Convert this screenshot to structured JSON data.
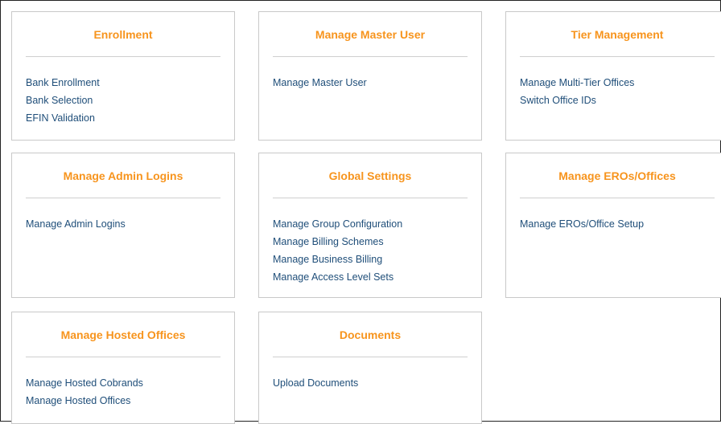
{
  "cards": [
    {
      "title": "Enrollment",
      "links": [
        "Bank Enrollment",
        "Bank Selection",
        "EFIN Validation"
      ]
    },
    {
      "title": "Manage Master User",
      "links": [
        "Manage Master User"
      ]
    },
    {
      "title": "Tier Management",
      "links": [
        "Manage Multi-Tier Offices",
        "Switch Office IDs"
      ]
    },
    {
      "title": "Manage Admin Logins",
      "links": [
        "Manage Admin Logins"
      ]
    },
    {
      "title": "Global Settings",
      "links": [
        "Manage Group Configuration",
        "Manage Billing Schemes",
        "Manage Business Billing",
        "Manage Access Level Sets"
      ]
    },
    {
      "title": "Manage EROs/Offices",
      "links": [
        "Manage EROs/Office Setup"
      ]
    },
    {
      "title": "Manage Hosted Offices",
      "links": [
        "Manage Hosted Cobrands",
        "Manage Hosted Offices"
      ]
    },
    {
      "title": "Documents",
      "links": [
        "Upload Documents"
      ]
    }
  ],
  "colors": {
    "title": "#f7941d",
    "link": "#1f4e79",
    "card_border": "#c9c9c9"
  }
}
